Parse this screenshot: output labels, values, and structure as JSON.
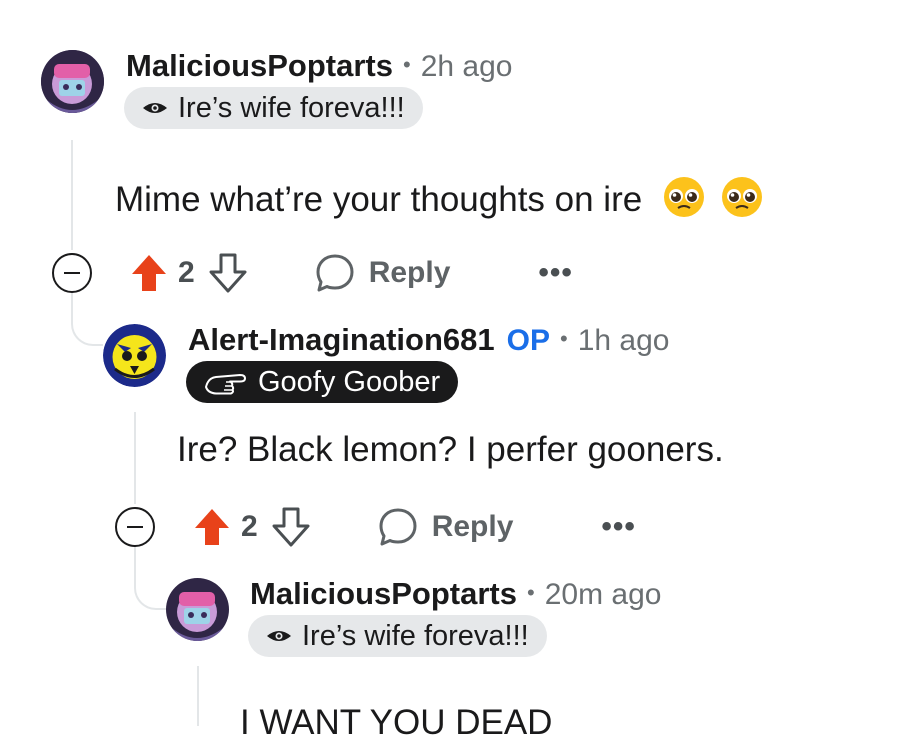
{
  "comments": [
    {
      "username": "MaliciousPoptarts",
      "time": "2h ago",
      "flair": "Ire’s wife foreva!!!",
      "body": "Mime what’re your thoughts on ire",
      "emojis": [
        "pleading-face",
        "pleading-face"
      ],
      "votes": "2",
      "reply_label": "Reply",
      "more_label": "•••"
    },
    {
      "username": "Alert-Imagination681",
      "op_label": "OP",
      "time": "1h ago",
      "flair": "Goofy Goober",
      "body": "Ire? Black lemon? I perfer gooners.",
      "votes": "2",
      "reply_label": "Reply",
      "more_label": "•••"
    },
    {
      "username": "MaliciousPoptarts",
      "time": "20m ago",
      "flair": "Ire’s wife foreva!!!",
      "body": "I WANT YOU DEAD"
    }
  ],
  "meta_separator": "•",
  "colors": {
    "upvote": "#e8421a",
    "op": "#1a6ee8",
    "thread_line": "#e3e6e8",
    "flair_light": "#e6e8ea",
    "flair_dark": "#1a1a1b"
  },
  "icons": {
    "collapse": "minus-circle-icon",
    "upvote": "upvote-arrow-icon",
    "downvote": "downvote-arrow-icon",
    "reply": "speech-bubble-icon",
    "more": "ellipsis-icon",
    "flair_eye": "eye-icon",
    "flair_hand": "pointing-hand-icon"
  }
}
